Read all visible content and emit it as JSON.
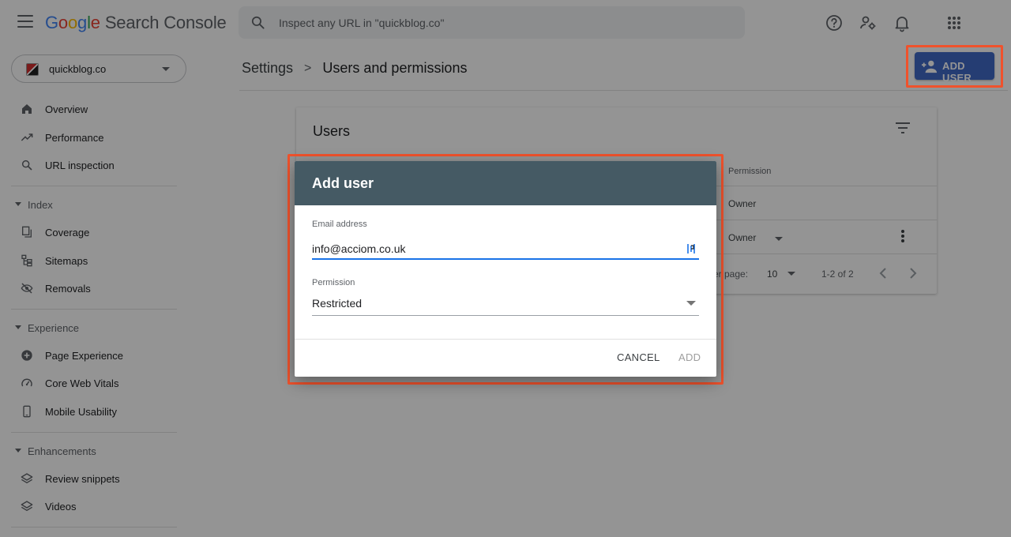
{
  "app": {
    "logo_letters": [
      "G",
      "o",
      "o",
      "g",
      "l",
      "e"
    ],
    "product_name": "Search Console"
  },
  "search": {
    "placeholder": "Inspect any URL in \"quickblog.co\""
  },
  "property": {
    "name": "quickblog.co"
  },
  "sidebar": {
    "overview": "Overview",
    "performance": "Performance",
    "url_inspection": "URL inspection",
    "index_section": "Index",
    "coverage": "Coverage",
    "sitemaps": "Sitemaps",
    "removals": "Removals",
    "experience_section": "Experience",
    "page_experience": "Page Experience",
    "core_web_vitals": "Core Web Vitals",
    "mobile_usability": "Mobile Usability",
    "enhancements_section": "Enhancements",
    "review_snippets": "Review snippets",
    "videos": "Videos"
  },
  "breadcrumb": {
    "parent": "Settings",
    "separator": ">",
    "current": "Users and permissions"
  },
  "toolbar": {
    "add_user_label": "ADD USER"
  },
  "users_card": {
    "title": "Users",
    "permission_header": "Permission",
    "rows": [
      {
        "permission": "Owner"
      },
      {
        "permission": "Owner"
      }
    ],
    "pager": {
      "rows_per_page_label": "er page:",
      "rows_per_page_value": "10",
      "range": "1-2 of 2"
    }
  },
  "dialog": {
    "title": "Add user",
    "email_label": "Email address",
    "email_value": "info@acciom.co.uk",
    "permission_label": "Permission",
    "permission_value": "Restricted",
    "cancel_label": "CANCEL",
    "add_label": "ADD"
  },
  "colors": {
    "accent": "#4169c6",
    "dialog_header": "#455a64",
    "focus": "#1a73e8",
    "highlight": "#f0522c"
  },
  "icons": {
    "menu": "hamburger-icon",
    "search": "search-icon",
    "help": "help-icon",
    "account_settings": "manage-accounts-icon",
    "notifications": "bell-icon",
    "apps": "apps-grid-icon",
    "filter": "filter-icon"
  }
}
